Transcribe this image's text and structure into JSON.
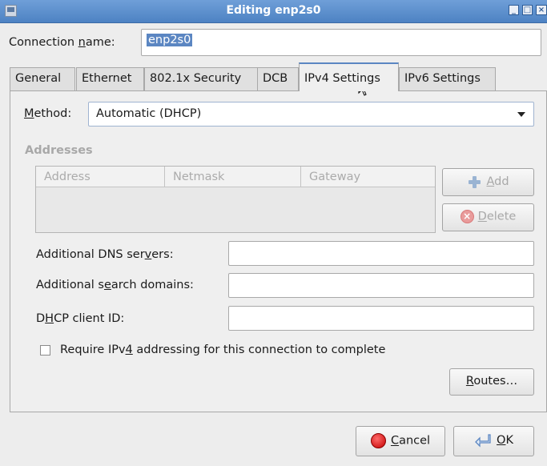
{
  "window": {
    "title": "Editing enp2s0"
  },
  "connection": {
    "label_pre": "Connection ",
    "label_key": "n",
    "label_post": "ame:",
    "name_value": "enp2s0"
  },
  "tabs": [
    {
      "label": "General",
      "active": false
    },
    {
      "label": "Ethernet",
      "active": false
    },
    {
      "label": "802.1x Security",
      "active": false
    },
    {
      "label": "DCB",
      "active": false
    },
    {
      "label": "IPv4 Settings",
      "active": true
    },
    {
      "label": "IPv6 Settings",
      "active": false
    }
  ],
  "ipv4": {
    "method_label_key": "M",
    "method_label_rest": "ethod:",
    "method_value": "Automatic (DHCP)",
    "addresses_heading": "Addresses",
    "columns": [
      "Address",
      "Netmask",
      "Gateway"
    ],
    "add_key": "A",
    "add_rest": "dd",
    "delete_key": "D",
    "delete_rest": "elete",
    "dns": {
      "pre": "Additional DNS ser",
      "key": "v",
      "post": "ers:",
      "value": ""
    },
    "search": {
      "pre": "Additional s",
      "key": "e",
      "post": "arch domains:",
      "value": ""
    },
    "dhcp": {
      "pre": "D",
      "key": "H",
      "post": "CP client ID:",
      "value": ""
    },
    "require": {
      "pre": "Require IPv",
      "key": "4",
      "post": " addressing for this connection to complete",
      "checked": false
    },
    "routes_key": "R",
    "routes_rest": "outes…"
  },
  "footer": {
    "cancel_key": "C",
    "cancel_rest": "ancel",
    "ok_key": "O",
    "ok_rest": "K"
  },
  "colors": {
    "titlebar": "#5a8dcc",
    "selection": "#5b86c2",
    "disabled_text": "#a8a8a8"
  }
}
